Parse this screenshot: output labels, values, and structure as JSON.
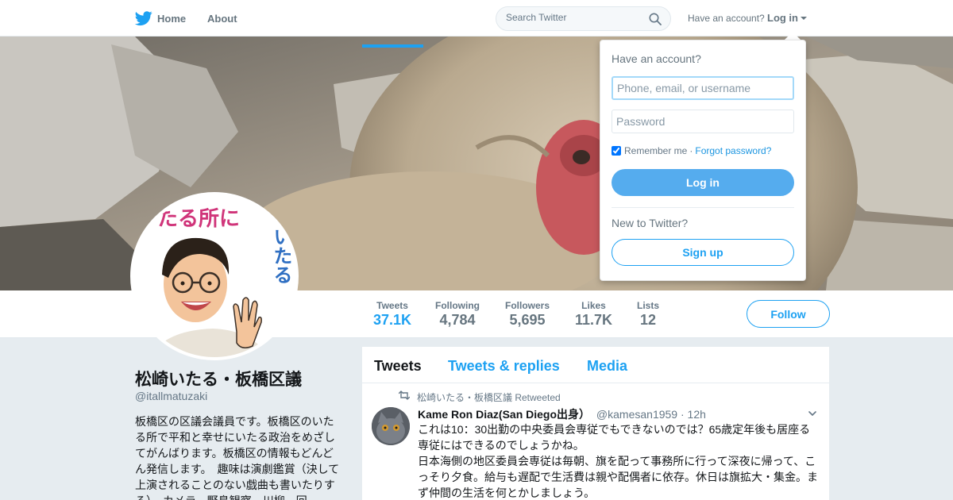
{
  "nav": {
    "home_label": "Home",
    "about_label": "About",
    "search_placeholder": "Search Twitter",
    "have_account": "Have an account?",
    "login_label": "Log in"
  },
  "colors": {
    "accent": "#1da1f2",
    "login_button": "#55acee",
    "muted_text": "#657786",
    "page_background": "#e6ecf0"
  },
  "icons": {
    "logo": "twitter-bird-icon",
    "search": "search-icon",
    "retweet": "retweet-icon",
    "menu": "chevron-down-icon"
  },
  "profile": {
    "name": "松崎いたる・板橋区議",
    "handle": "@itallmatuzaki",
    "bio": "板橋区の区議会議員です。板橋区のいたる所で平和と幸せにいたる政治をめざしてがんばります。板橋区の情報もどんどん発信します。　趣味は演劇鑑賞（決して上演されることのない戯曲も書いたりする）、カメラ、野鳥観察、川柳、回",
    "avatar_text_top": "たる所に",
    "avatar_text_side": "いたる"
  },
  "stats": [
    {
      "label": "Tweets",
      "value": "37.1K"
    },
    {
      "label": "Following",
      "value": "4,784"
    },
    {
      "label": "Followers",
      "value": "5,695"
    },
    {
      "label": "Likes",
      "value": "11.7K"
    },
    {
      "label": "Lists",
      "value": "12"
    }
  ],
  "follow_label": "Follow",
  "timeline": {
    "tabs": [
      "Tweets",
      "Tweets & replies",
      "Media"
    ],
    "tweet": {
      "retweeted_by": "松崎いたる・板橋区議 Retweeted",
      "author_name": "Kame Ron Diaz(San Diego出身）",
      "author_handle": "@kamesan1959",
      "time": "· 12h",
      "lines": [
        "これは10：30出勤の中央委員会専従でもできないのでは？65歳定年後も居座る専従にはできるのでしょうかね。",
        "日本海側の地区委員会専従は毎朝、旗を配って事務所に行って深夜に帰って、こっそり夕食。給与も遅配で生活費は親や配偶者に依存。休日は旗拡大・集金。まず仲間の生活を何とかしましょう。"
      ]
    }
  },
  "login_dropdown": {
    "title": "Have an account?",
    "username_placeholder": "Phone, email, or username",
    "password_placeholder": "Password",
    "remember_me": "Remember me",
    "separator": "·",
    "forgot_password": "Forgot password?",
    "login_button": "Log in",
    "new_to_twitter": "New to Twitter?",
    "signup_button": "Sign up"
  }
}
